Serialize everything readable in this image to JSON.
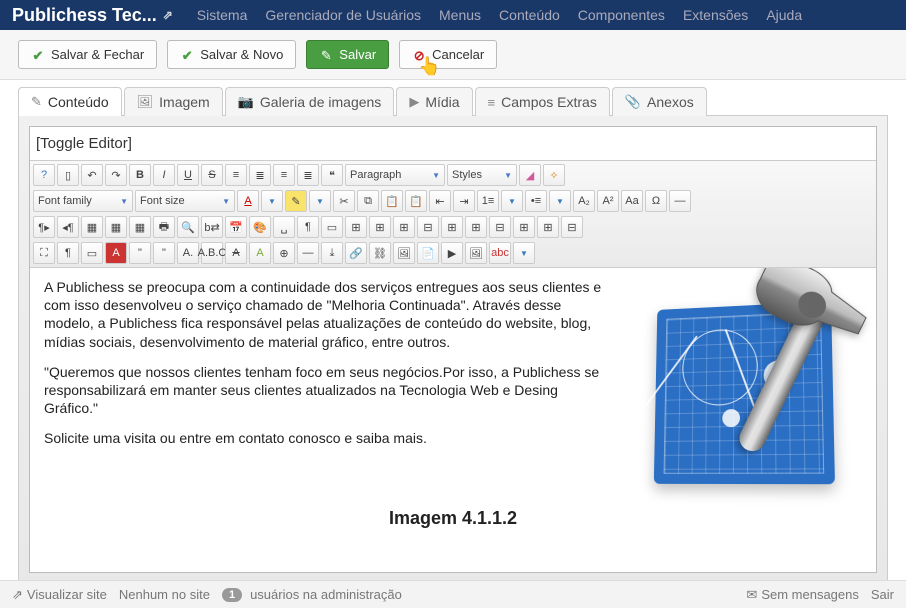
{
  "topbar": {
    "brand": "Publichess Tec...",
    "nav": [
      "Sistema",
      "Gerenciador de Usuários",
      "Menus",
      "Conteúdo",
      "Componentes",
      "Extensões",
      "Ajuda"
    ]
  },
  "actions": {
    "save_close": "Salvar & Fechar",
    "save_new": "Salvar & Novo",
    "save": "Salvar",
    "cancel": "Cancelar"
  },
  "tabs": [
    {
      "icon": "✎",
      "label": "Conteúdo",
      "active": true
    },
    {
      "icon": "🖼",
      "label": "Imagem"
    },
    {
      "icon": "📷",
      "label": "Galeria de imagens"
    },
    {
      "icon": "▶",
      "label": "Mídia"
    },
    {
      "icon": "≡",
      "label": "Campos Extras"
    },
    {
      "icon": "📎",
      "label": "Anexos"
    }
  ],
  "editor": {
    "toggle": "[Toggle Editor]",
    "paragraph": "Paragraph",
    "styles": "Styles",
    "font_family": "Font family",
    "font_size": "Font size"
  },
  "content": {
    "p1": "A Publichess se preocupa com a continuidade dos serviços entregues aos seus clientes e com isso desenvolveu o serviço chamado de \"Melhoria Continuada\". Através desse modelo, a Publichess fica responsável pelas atualizações de conteúdo do website, blog, mídias sociais, desenvolvimento de material gráfico, entre outros.",
    "p2": "\"Queremos que nossos clientes tenham foco em seus negócios.Por isso, a Publichess se responsabilizará em manter seus clientes atualizados na Tecnologia Web e Desing Gráfico.\"",
    "p3": "Solicite uma visita ou entre em contato conosco e saiba mais.",
    "caption": "Imagem 4.1.1.2"
  },
  "statusbar": {
    "view_site": "Visualizar site",
    "no_visitors": "Nenhum no site",
    "admins_count": "1",
    "admins_label": "usuários na administração",
    "no_messages": "Sem mensagens",
    "logout": "Sair"
  }
}
